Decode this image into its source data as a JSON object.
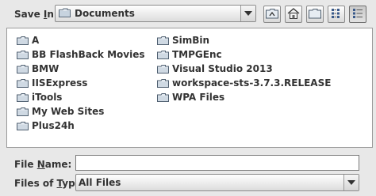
{
  "save_in": {
    "label_pre": "Save ",
    "label_mnemonic": "I",
    "label_post": "n:",
    "value": "Documents"
  },
  "toolbar": {
    "icons": [
      "up-one-level-icon",
      "home-icon",
      "new-folder-icon",
      "list-view-icon",
      "details-view-icon"
    ]
  },
  "files": {
    "left": [
      "A",
      "BB FlashBack Movies",
      "BMW",
      "IISExpress",
      "iTools",
      "My Web Sites",
      "Plus24h"
    ],
    "right": [
      "SimBin",
      "TMPGEnc",
      "Visual Studio 2013",
      "workspace-sts-3.7.3.RELEASE",
      "WPA Files"
    ]
  },
  "file_name": {
    "label_pre": "File ",
    "label_mnemonic": "N",
    "label_post": "ame:",
    "value": ""
  },
  "files_of_type": {
    "label_pre": "Files of ",
    "label_mnemonic": "T",
    "label_post": "ype:",
    "value": "All Files"
  }
}
